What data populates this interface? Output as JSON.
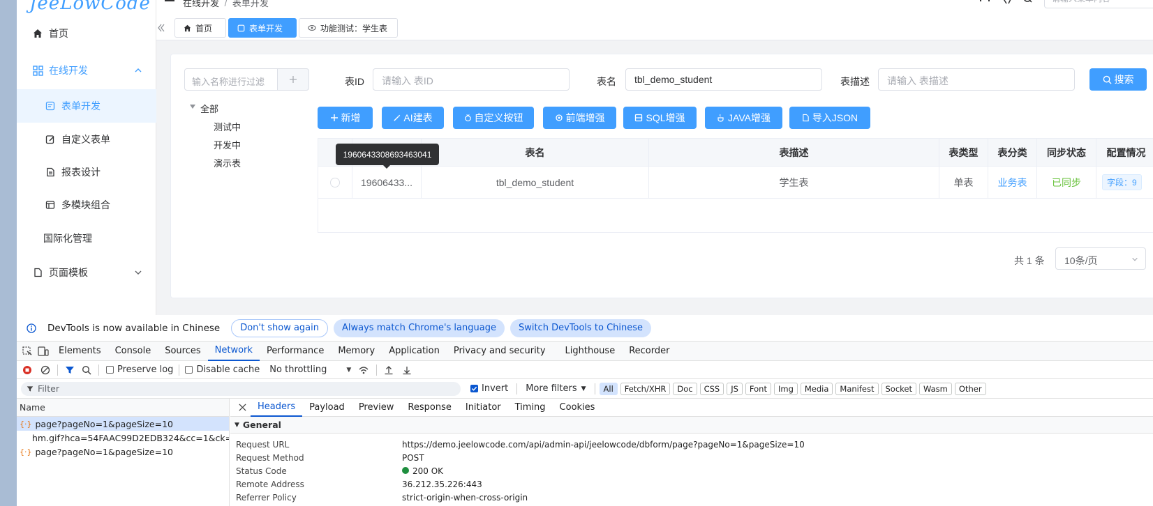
{
  "logo": "JeeLowCode",
  "breadcrumb": {
    "root": "在线开发",
    "sep": "/",
    "current": "表单开发"
  },
  "top_search": {
    "placeholder": "请输入菜单内容"
  },
  "sidebar": {
    "items": [
      {
        "label": "首页",
        "icon": "home-icon"
      },
      {
        "label": "在线开发",
        "icon": "online-dev-icon",
        "expanded": true
      },
      {
        "label": "表单开发",
        "icon": "form-dev-icon",
        "active": true
      },
      {
        "label": "自定义表单",
        "icon": "edit-form-icon"
      },
      {
        "label": "报表设计",
        "icon": "report-icon"
      },
      {
        "label": "多模块组合",
        "icon": "module-icon"
      },
      {
        "label": "国际化管理",
        "icon": ""
      },
      {
        "label": "页面模板",
        "icon": "template-icon",
        "expanded": false
      }
    ]
  },
  "tabs": [
    {
      "label": "首页",
      "icon": "home-icon"
    },
    {
      "label": "表单开发",
      "icon": "form-dev-icon",
      "active": true
    },
    {
      "label": "功能测试：学生表",
      "icon": "eye-icon"
    }
  ],
  "tree": {
    "filter_placeholder": "输入名称进行过滤",
    "root": "全部",
    "children": [
      "测试中",
      "开发中",
      "演示表"
    ]
  },
  "filters": {
    "table_id": {
      "label": "表ID",
      "placeholder": "请输入 表ID",
      "value": ""
    },
    "table_name": {
      "label": "表名",
      "placeholder": "请输入 表名",
      "value": "tbl_demo_student"
    },
    "table_desc": {
      "label": "表描述",
      "placeholder": "请输入 表描述",
      "value": ""
    },
    "search_label": "搜索"
  },
  "toolbar": {
    "add": "新增",
    "ai": "AI建表",
    "custom_btn": "自定义按钮",
    "frontend": "前端增强",
    "sql": "SQL增强",
    "java": "JAVA增强",
    "import_json": "导入JSON"
  },
  "table": {
    "columns": [
      "表名",
      "表描述",
      "表类型",
      "表分类",
      "同步状态",
      "配置情况"
    ],
    "rows": [
      {
        "id_short": "19606433...",
        "id_full": "1960643308693463041",
        "name": "tbl_demo_student",
        "desc": "学生表",
        "type": "单表",
        "category": "业务表",
        "sync": "已同步",
        "config": "字段：9"
      }
    ]
  },
  "pager": {
    "total": "共 1 条",
    "size": "10条/页"
  },
  "colors": {
    "primary": "#409eff",
    "success": "#67c23a"
  },
  "devtools": {
    "banner": {
      "message": "DevTools is now available in Chinese",
      "dont_show": "Don't show again",
      "always_match": "Always match Chrome's language",
      "switch": "Switch DevTools to Chinese"
    },
    "tabs": [
      "Elements",
      "Console",
      "Sources",
      "Network",
      "Performance",
      "Memory",
      "Application",
      "Privacy and security",
      "Lighthouse",
      "Recorder"
    ],
    "active_tab": "Network",
    "toolbar": {
      "preserve_log": "Preserve log",
      "disable_cache": "Disable cache",
      "throttling": "No throttling"
    },
    "filterbar": {
      "placeholder": "Filter",
      "invert": "Invert",
      "more_filters": "More filters",
      "types": [
        "All",
        "Fetch/XHR",
        "Doc",
        "CSS",
        "JS",
        "Font",
        "Img",
        "Media",
        "Manifest",
        "Socket",
        "Wasm",
        "Other"
      ]
    },
    "list": {
      "header": "Name",
      "rows": [
        {
          "name": "page?pageNo=1&pageSize=10",
          "type": "xhr",
          "selected": true
        },
        {
          "name": "hm.gif?hca=54FAAC99D2EDB324&cc=1&ck=1&c...",
          "type": "img",
          "selected": false
        },
        {
          "name": "page?pageNo=1&pageSize=10",
          "type": "xhr",
          "selected": false
        }
      ]
    },
    "detail_tabs": [
      "Headers",
      "Payload",
      "Preview",
      "Response",
      "Initiator",
      "Timing",
      "Cookies"
    ],
    "section": "General",
    "general": [
      {
        "key": "Request URL",
        "value": "https://demo.jeelowcode.com/api/admin-api/jeelowcode/dbform/page?pageNo=1&pageSize=10"
      },
      {
        "key": "Request Method",
        "value": "POST"
      },
      {
        "key": "Status Code",
        "value": "200 OK"
      },
      {
        "key": "Remote Address",
        "value": "36.212.35.226:443"
      },
      {
        "key": "Referrer Policy",
        "value": "strict-origin-when-cross-origin"
      }
    ]
  }
}
